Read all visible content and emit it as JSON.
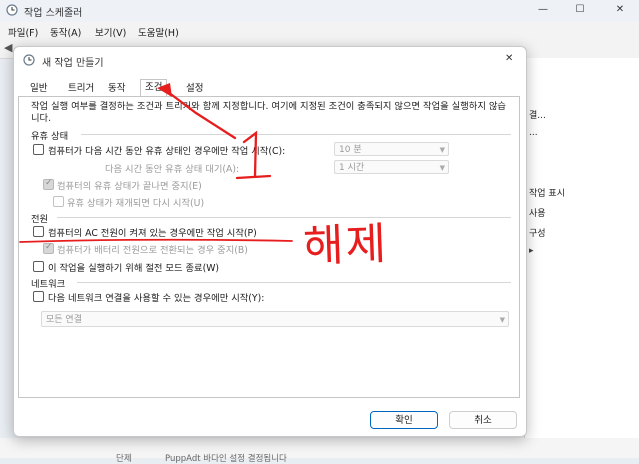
{
  "main_window": {
    "title": "작업 스케줄러",
    "menu": [
      "파일(F)",
      "동작(A)",
      "보기(V)",
      "도움말(H)"
    ],
    "right_pane_items": [
      "결...",
      "...",
      "작업 표시",
      "사용",
      "구성"
    ]
  },
  "dialog": {
    "title": "새 작업 만들기",
    "tabs": [
      "일반",
      "트리거",
      "동작",
      "조건",
      "설정"
    ],
    "active_tab": "조건",
    "description": "작업 실행 여부를 결정하는 조건과 트리거와 함께 지정합니다. 여기에 지정된 조건이 충족되지 않으면 작업을 실행하지 않습니다.",
    "idle": {
      "section": "유휴 상태",
      "start_if_idle": {
        "label": "컴퓨터가 다음 시간 동안 유휴 상태인 경우에만 작업 시작(C):",
        "checked": false
      },
      "idle_for_value": "10 분",
      "wait_label": "다음 시간 동안 유휴 상태 대기(A):",
      "wait_value": "1 시간",
      "stop_if_not_idle": {
        "label": "컴퓨터의 유휴 상태가 끝나면 중지(E)",
        "checked": true,
        "enabled": false
      },
      "restart_if_idle": {
        "label": "유휴 상태가 재개되면 다시 시작(U)",
        "checked": false,
        "enabled": false
      }
    },
    "power": {
      "section": "전원",
      "ac_only": {
        "label": "컴퓨터의 AC 전원이 켜져 있는 경우에만 작업 시작(P)",
        "checked": false
      },
      "stop_on_battery": {
        "label": "컴퓨터가 배터리 전원으로 전환되는 경우 중지(B)",
        "checked": true,
        "enabled": false
      },
      "wake_to_run": {
        "label": "이 작업을 실행하기 위해 절전 모드 종료(W)",
        "checked": false
      }
    },
    "network": {
      "section": "네트워크",
      "start_if_network": {
        "label": "다음 네트워크 연결을 사용할 수 있는 경우에만 시작(Y):",
        "checked": false
      },
      "connection_value": "모든 연결"
    },
    "ok_label": "확인",
    "cancel_label": "취소"
  },
  "annotations": {
    "step_number": "1",
    "instruction": "해제",
    "color": "#e61e1e"
  },
  "bottom_strip": [
    "단제",
    "PuppAdt 바다인 설정 결정됩니다"
  ]
}
